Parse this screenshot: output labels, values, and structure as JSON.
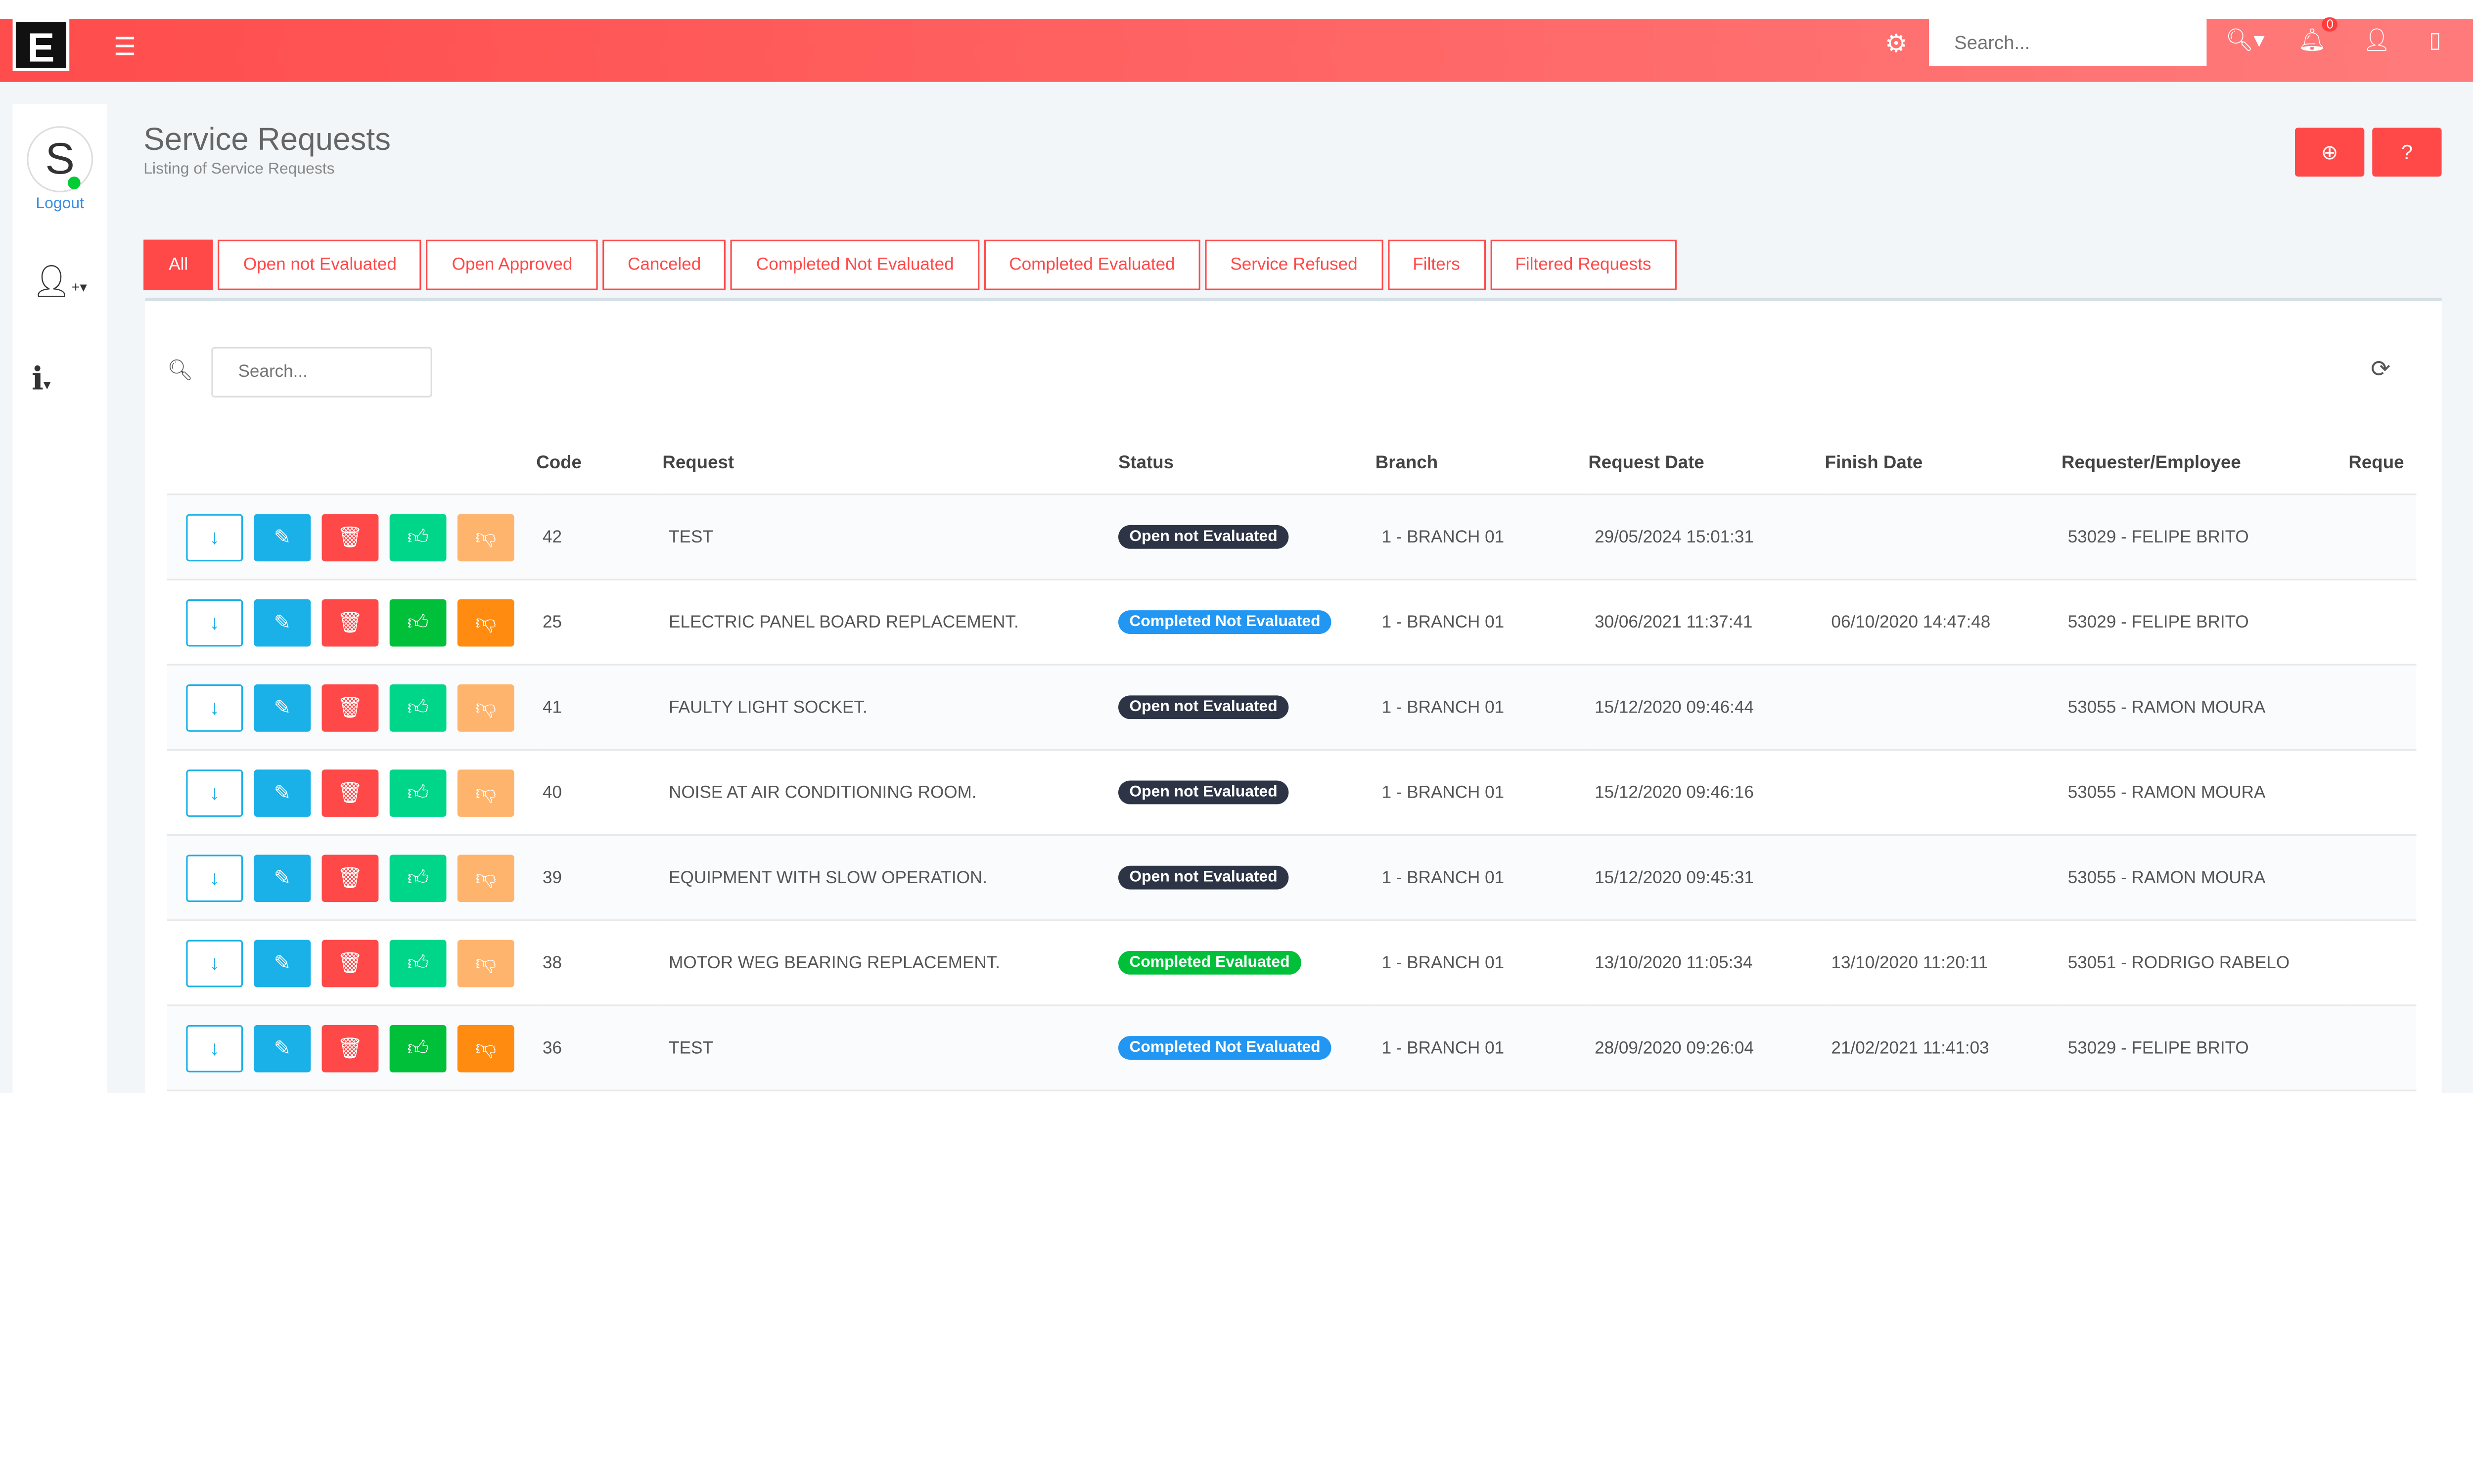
{
  "topbar": {
    "logo": "E",
    "search_placeholder": "Search...",
    "notification_count": "0"
  },
  "sidebar": {
    "avatar_letter": "S",
    "logout": "Logout"
  },
  "header": {
    "title": "Service Requests",
    "subtitle": "Listing of Service Requests"
  },
  "tabs": [
    {
      "label": "All",
      "active": true
    },
    {
      "label": "Open not Evaluated"
    },
    {
      "label": "Open Approved"
    },
    {
      "label": "Canceled"
    },
    {
      "label": "Completed Not Evaluated"
    },
    {
      "label": "Completed Evaluated"
    },
    {
      "label": "Service Refused"
    },
    {
      "label": "Filters"
    },
    {
      "label": "Filtered Requests"
    }
  ],
  "table": {
    "search_placeholder": "Search...",
    "columns": [
      "",
      "Code",
      "Request",
      "Status",
      "Branch",
      "Request Date",
      "Finish Date",
      "Requester/Employee",
      "Reque"
    ],
    "status_colors": {
      "Open not Evaluated": "#2d3446",
      "Completed Not Evaluated": "#2196f3",
      "Completed Evaluated": "#00c03a"
    },
    "rows": [
      {
        "code": "42",
        "request": "TEST",
        "status": "Open not Evaluated",
        "branch": "1 - BRANCH 01",
        "request_date": "29/05/2024 15:01:31",
        "finish_date": "",
        "requester": "53029 - FELIPE BRITO",
        "evaluable": false
      },
      {
        "code": "25",
        "request": "ELECTRIC PANEL BOARD REPLACEMENT.",
        "status": "Completed Not Evaluated",
        "branch": "1 - BRANCH 01",
        "request_date": "30/06/2021 11:37:41",
        "finish_date": "06/10/2020 14:47:48",
        "requester": "53029 - FELIPE BRITO",
        "evaluable": true
      },
      {
        "code": "41",
        "request": "FAULTY LIGHT SOCKET.",
        "status": "Open not Evaluated",
        "branch": "1 - BRANCH 01",
        "request_date": "15/12/2020 09:46:44",
        "finish_date": "",
        "requester": "53055 - RAMON MOURA",
        "evaluable": false
      },
      {
        "code": "40",
        "request": "NOISE AT AIR CONDITIONING ROOM.",
        "status": "Open not Evaluated",
        "branch": "1 - BRANCH 01",
        "request_date": "15/12/2020 09:46:16",
        "finish_date": "",
        "requester": "53055 - RAMON MOURA",
        "evaluable": false
      },
      {
        "code": "39",
        "request": "EQUIPMENT WITH SLOW OPERATION.",
        "status": "Open not Evaluated",
        "branch": "1 - BRANCH 01",
        "request_date": "15/12/2020 09:45:31",
        "finish_date": "",
        "requester": "53055 - RAMON MOURA",
        "evaluable": false
      },
      {
        "code": "38",
        "request": "MOTOR WEG BEARING REPLACEMENT.",
        "status": "Completed Evaluated",
        "branch": "1 - BRANCH 01",
        "request_date": "13/10/2020 11:05:34",
        "finish_date": "13/10/2020 11:20:11",
        "requester": "53051 - RODRIGO RABELO",
        "evaluable": false
      },
      {
        "code": "36",
        "request": "TEST",
        "status": "Completed Not Evaluated",
        "branch": "1 - BRANCH 01",
        "request_date": "28/09/2020 09:26:04",
        "finish_date": "21/02/2021 11:41:03",
        "requester": "53029 - FELIPE BRITO",
        "evaluable": true
      }
    ]
  },
  "colors": {
    "accent": "#ff4848"
  }
}
